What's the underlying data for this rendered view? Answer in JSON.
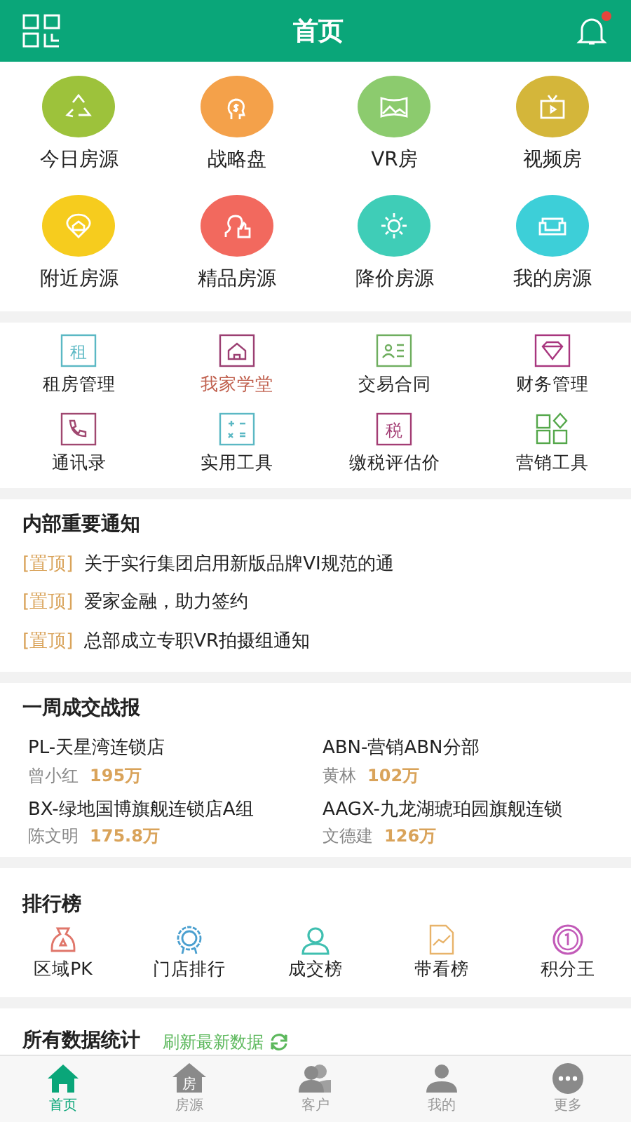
{
  "header": {
    "title": "首页",
    "has_unread": true
  },
  "quick_tiles": [
    {
      "label": "今日房源",
      "kind": "recycle",
      "color": "#9dc23b"
    },
    {
      "label": "战略盘",
      "kind": "head",
      "color": "#f4a14a"
    },
    {
      "label": "VR房",
      "kind": "panorama",
      "color": "#8ccb6e"
    },
    {
      "label": "视频房",
      "kind": "tv",
      "color": "#d4b63a"
    },
    {
      "label": "附近房源",
      "kind": "pin",
      "color": "#f6cc1e"
    },
    {
      "label": "精品房源",
      "kind": "thumb",
      "color": "#f2695e"
    },
    {
      "label": "降价房源",
      "kind": "sun",
      "color": "#3fcdb7"
    },
    {
      "label": "我的房源",
      "kind": "sofa",
      "color": "#3dcfd8"
    }
  ],
  "tools": [
    {
      "label": "租房管理",
      "kind": "text",
      "icon_text": "租",
      "color": "#5bb8c4",
      "highlighted": false
    },
    {
      "label": "我家学堂",
      "kind": "house",
      "color": "#9b3f72",
      "highlighted": true
    },
    {
      "label": "交易合同",
      "kind": "card",
      "color": "#6fae5f",
      "highlighted": false
    },
    {
      "label": "财务管理",
      "kind": "diamond",
      "color": "#a8367e",
      "highlighted": false
    },
    {
      "label": "通讯录",
      "kind": "phone",
      "color": "#a04870",
      "highlighted": false
    },
    {
      "label": "实用工具",
      "kind": "calc",
      "color": "#5bb8c4",
      "highlighted": false
    },
    {
      "label": "缴税评估价",
      "kind": "text",
      "icon_text": "税",
      "color": "#a33d74",
      "highlighted": false
    },
    {
      "label": "营销工具",
      "kind": "grid",
      "color": "#54a74a",
      "highlighted": false
    }
  ],
  "notices": {
    "title": "内部重要通知",
    "items": [
      {
        "tag": "[置顶]",
        "text": "关于实行集团启用新版品牌VI规范的通"
      },
      {
        "tag": "[置顶]",
        "text": "爱家金融，助力签约"
      },
      {
        "tag": "[置顶]",
        "text": "总部成立专职VR拍摄组通知"
      }
    ]
  },
  "weekly_report": {
    "title": "一周成交战报",
    "items": [
      {
        "store": "PL-天星湾连锁店",
        "agent": "曾小红",
        "amount": "195万"
      },
      {
        "store": "ABN-营销ABN分部",
        "agent": "黄林",
        "amount": "102万"
      },
      {
        "store": "BX-绿地国博旗舰连锁店A组",
        "agent": "陈文明",
        "amount": "175.8万"
      },
      {
        "store": "AAGX-九龙湖琥珀园旗舰连锁",
        "agent": "文德建",
        "amount": "126万"
      }
    ]
  },
  "rankings": {
    "title": "排行榜",
    "items": [
      {
        "label": "区域PK",
        "kind": "bag",
        "color": "#e0766a"
      },
      {
        "label": "门店排行",
        "kind": "medal",
        "color": "#4a9fcf"
      },
      {
        "label": "成交榜",
        "kind": "person",
        "color": "#3fbfb0"
      },
      {
        "label": "带看榜",
        "kind": "chart",
        "color": "#e8b36a"
      },
      {
        "label": "积分王",
        "kind": "coin",
        "color": "#c25ab8"
      }
    ]
  },
  "stats": {
    "title": "所有数据统计",
    "refresh": "刷新最新数据"
  },
  "tab_bar": [
    {
      "label": "首页",
      "kind": "home",
      "selected": true
    },
    {
      "label": "房源",
      "kind": "house",
      "icon_text": "房",
      "selected": false
    },
    {
      "label": "客户",
      "kind": "people",
      "selected": false
    },
    {
      "label": "我的",
      "kind": "person",
      "selected": false
    },
    {
      "label": "更多",
      "kind": "more",
      "selected": false
    }
  ]
}
